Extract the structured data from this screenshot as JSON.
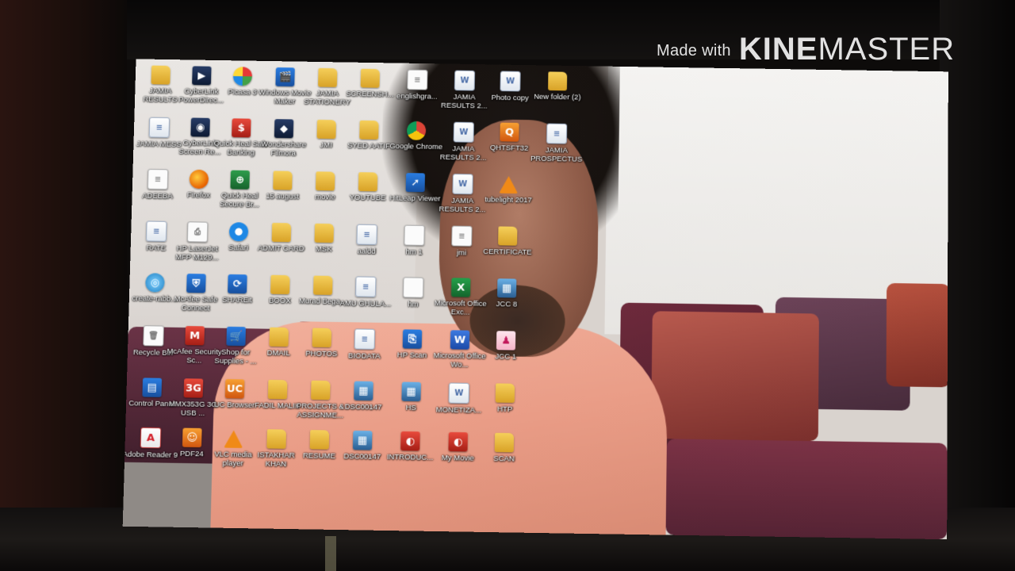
{
  "watermark": {
    "prefix": "Made with",
    "brand_bold": "KINE",
    "brand_light": "MASTER"
  },
  "desktop": {
    "icons": [
      {
        "label": "JAMIA RESULTS",
        "icon": "folder-icon",
        "glyph": ""
      },
      {
        "label": "CyberLink PowerDirec...",
        "icon": "cyberlink-powerdirector-icon",
        "glyph": "▶"
      },
      {
        "label": "Picasa 3",
        "icon": "picasa-icon",
        "glyph": ""
      },
      {
        "label": "Windows Movie Maker",
        "icon": "movie-maker-icon",
        "glyph": "🎬"
      },
      {
        "label": "JAMIA STATIONERY",
        "icon": "folder-icon",
        "glyph": ""
      },
      {
        "label": "SCREENSH...",
        "icon": "folder-icon",
        "glyph": ""
      },
      {
        "label": "englishgra...",
        "icon": "text-file-icon",
        "glyph": "≡"
      },
      {
        "label": "JAMIA RESULTS 2...",
        "icon": "word-document-icon",
        "glyph": "W"
      },
      {
        "label": "Photo copy",
        "icon": "word-document-icon",
        "glyph": "W"
      },
      {
        "label": "New folder (2)",
        "icon": "folder-icon",
        "glyph": ""
      },
      {
        "label": "JAMIA MESS",
        "icon": "document-icon",
        "glyph": "≡"
      },
      {
        "label": "CyberLink Screen Re...",
        "icon": "cyberlink-screen-recorder-icon",
        "glyph": "◉"
      },
      {
        "label": "Quick Heal Safe Banking",
        "icon": "quick-heal-icon",
        "glyph": "$"
      },
      {
        "label": "Wondershare Filmora",
        "icon": "filmora-icon",
        "glyph": "◆"
      },
      {
        "label": "JMI",
        "icon": "folder-icon",
        "glyph": ""
      },
      {
        "label": "SYED AATIF",
        "icon": "folder-icon",
        "glyph": ""
      },
      {
        "label": "Google Chrome",
        "icon": "chrome-icon",
        "glyph": ""
      },
      {
        "label": "JAMIA RESULTS 2...",
        "icon": "word-document-icon",
        "glyph": "W"
      },
      {
        "label": "QHTSFT32",
        "icon": "quick-heal-tool-icon",
        "glyph": "Q"
      },
      {
        "label": "JAMIA PROSPECTUS",
        "icon": "document-icon",
        "glyph": "≡"
      },
      {
        "label": "ADEEBA",
        "icon": "text-file-icon",
        "glyph": "≡"
      },
      {
        "label": "Firefox",
        "icon": "firefox-icon",
        "glyph": ""
      },
      {
        "label": "Quick Heal Secure Br...",
        "icon": "quick-heal-browser-icon",
        "glyph": "⊕"
      },
      {
        "label": "15 august",
        "icon": "folder-icon",
        "glyph": ""
      },
      {
        "label": "movie",
        "icon": "folder-icon",
        "glyph": ""
      },
      {
        "label": "YOUTUBE",
        "icon": "folder-icon",
        "glyph": ""
      },
      {
        "label": "HitLeap Viewer",
        "icon": "hitleap-icon",
        "glyph": "➚"
      },
      {
        "label": "JAMIA RESULTS 2...",
        "icon": "word-document-icon",
        "glyph": "W"
      },
      {
        "label": "tubelight 2017",
        "icon": "vlc-icon",
        "glyph": ""
      },
      {
        "label": "RATE",
        "icon": "document-icon",
        "glyph": "≡"
      },
      {
        "label": "HP LaserJet MFP M129...",
        "icon": "printer-icon",
        "glyph": "⎙"
      },
      {
        "label": "Safari",
        "icon": "safari-icon",
        "glyph": ""
      },
      {
        "label": "ADMIT CARD",
        "icon": "folder-icon",
        "glyph": ""
      },
      {
        "label": "MSK",
        "icon": "folder-icon",
        "glyph": ""
      },
      {
        "label": "aaldd",
        "icon": "document-icon",
        "glyph": "≡"
      },
      {
        "label": "hm 1",
        "icon": "text-file-icon",
        "glyph": ""
      },
      {
        "label": "jmi",
        "icon": "text-file-icon",
        "glyph": "≡"
      },
      {
        "label": "CERTIFICATE",
        "icon": "folder-icon",
        "glyph": ""
      },
      {
        "label": "create-rabb...",
        "icon": "settings-file-icon",
        "glyph": "◎"
      },
      {
        "label": "McAfee Safe Connect",
        "icon": "mcafee-safe-connect-icon",
        "glyph": "⛨"
      },
      {
        "label": "SHAREit",
        "icon": "shareit-icon",
        "glyph": "⟳"
      },
      {
        "label": "BOOX",
        "icon": "folder-icon",
        "glyph": ""
      },
      {
        "label": "Murad Bega...",
        "icon": "folder-icon",
        "glyph": ""
      },
      {
        "label": "AMU GHULA...",
        "icon": "document-icon",
        "glyph": "≡"
      },
      {
        "label": "hm",
        "icon": "text-file-icon",
        "glyph": ""
      },
      {
        "label": "Microsoft Office Exc...",
        "icon": "excel-icon",
        "glyph": "X"
      },
      {
        "label": "JCC 8",
        "icon": "image-file-icon",
        "glyph": "▦"
      },
      {
        "label": "Recycle Bin",
        "icon": "recycle-bin-icon",
        "glyph": "🗑"
      },
      {
        "label": "McAfee Security Sc...",
        "icon": "mcafee-icon",
        "glyph": "M"
      },
      {
        "label": "Shop for Supplies - ...",
        "icon": "hp-shop-icon",
        "glyph": "🛒"
      },
      {
        "label": "DMAIL",
        "icon": "folder-icon",
        "glyph": ""
      },
      {
        "label": "PHOTOS",
        "icon": "folder-icon",
        "glyph": ""
      },
      {
        "label": "BIODATA",
        "icon": "document-icon",
        "glyph": "≡"
      },
      {
        "label": "HP Scan",
        "icon": "hp-scan-icon",
        "glyph": "⎘"
      },
      {
        "label": "Microsoft Office Wo...",
        "icon": "word-icon",
        "glyph": "W"
      },
      {
        "label": "JCC 1",
        "icon": "pdf-file-icon",
        "glyph": "♟"
      },
      {
        "label": "Control Panel",
        "icon": "control-panel-icon",
        "glyph": "▤"
      },
      {
        "label": "MMX353G 3G USB ...",
        "icon": "usb-modem-icon",
        "glyph": "3G"
      },
      {
        "label": "UC Browser",
        "icon": "uc-browser-icon",
        "glyph": "UC"
      },
      {
        "label": "FADIL MALIK",
        "icon": "folder-icon",
        "glyph": ""
      },
      {
        "label": "PROJECTS & ASSIGNME...",
        "icon": "folder-icon",
        "glyph": ""
      },
      {
        "label": "DSC00147",
        "icon": "image-file-icon",
        "glyph": "▦"
      },
      {
        "label": "HS",
        "icon": "image-file-icon",
        "glyph": "▦"
      },
      {
        "label": "MONETIZA...",
        "icon": "word-document-icon",
        "glyph": "W"
      },
      {
        "label": "HTP",
        "icon": "folder-icon",
        "glyph": ""
      },
      {
        "label": "Adobe Reader 9",
        "icon": "adobe-reader-icon",
        "glyph": "A"
      },
      {
        "label": "PDF24",
        "icon": "pdf24-icon",
        "glyph": "☺"
      },
      {
        "label": "VLC media player",
        "icon": "vlc-icon",
        "glyph": ""
      },
      {
        "label": "ISTAKHAR KHAN",
        "icon": "folder-icon",
        "glyph": ""
      },
      {
        "label": "RESUME",
        "icon": "folder-icon",
        "glyph": ""
      },
      {
        "label": "DSC00147",
        "icon": "image-file-icon",
        "glyph": "▦"
      },
      {
        "label": "INTRODUC...",
        "icon": "video-file-icon",
        "glyph": "◐"
      },
      {
        "label": "My Movie",
        "icon": "video-file-icon",
        "glyph": "◐"
      },
      {
        "label": "SCAN",
        "icon": "folder-icon",
        "glyph": ""
      }
    ]
  }
}
